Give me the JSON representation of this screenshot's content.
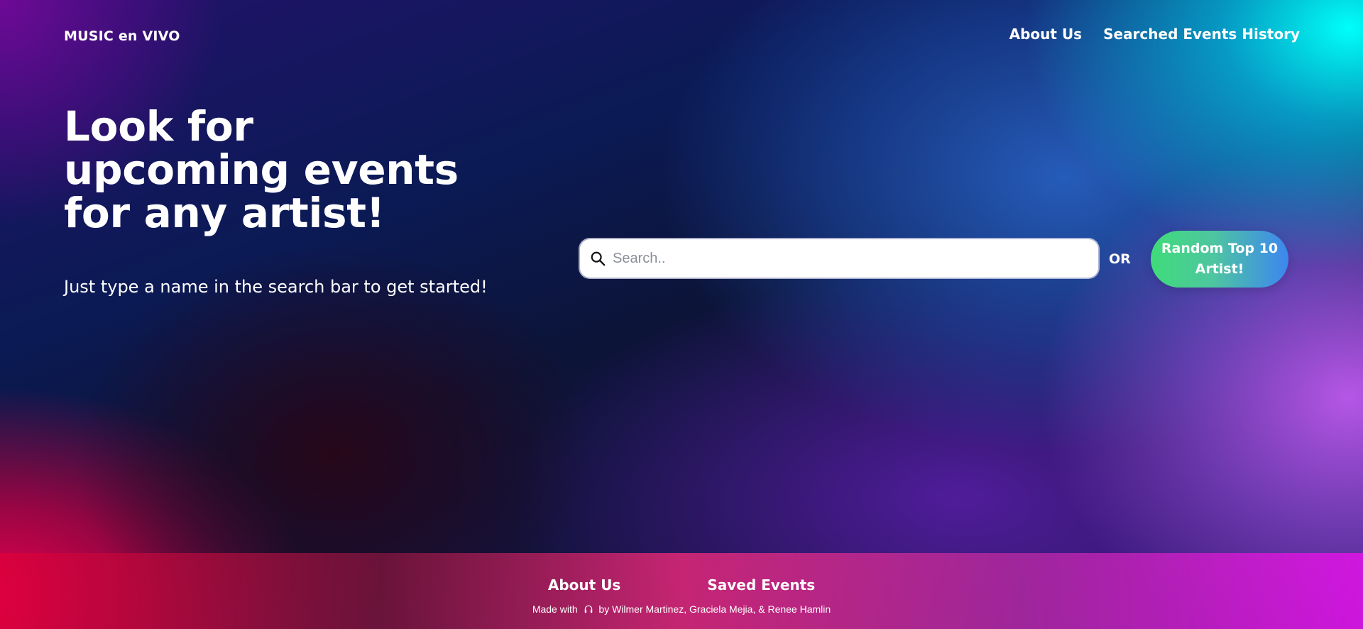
{
  "header": {
    "brand": "MUSIC en VIVO",
    "nav": [
      {
        "label": "About Us"
      },
      {
        "label": "Searched Events History"
      }
    ]
  },
  "hero": {
    "title": "Look for upcoming events for any artist!",
    "subtitle": "Just type a name in the search bar to get started!"
  },
  "search": {
    "placeholder": "Search..",
    "value": "",
    "icon": "search-icon"
  },
  "or_label": "OR",
  "random_button": {
    "label": "Random Top 10 Artist!"
  },
  "footer": {
    "links": [
      {
        "label": "About Us"
      },
      {
        "label": "Saved Events"
      }
    ],
    "credit_prefix": "Made with",
    "credit_icon": "headphones-icon",
    "credit_suffix": "by Wilmer Martinez, Graciela Mejia, & Renee Hamlin"
  },
  "colors": {
    "button_gradient_start": "#3fdc7a",
    "button_gradient_end": "#3d86f0",
    "text": "#ffffff"
  }
}
